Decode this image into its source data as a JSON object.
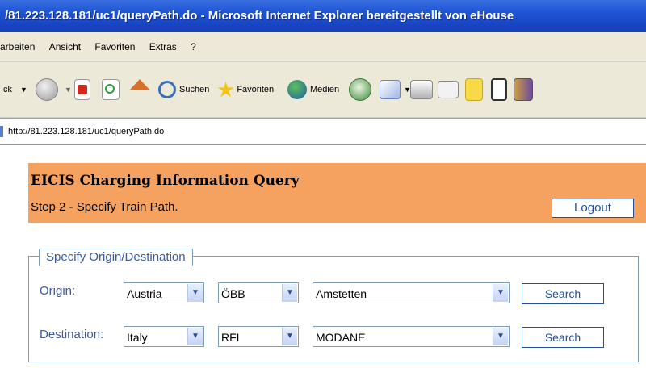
{
  "window": {
    "title": "/81.223.128.181/uc1/queryPath.do - Microsoft Internet Explorer bereitgestellt von eHouse"
  },
  "menu": {
    "items": [
      "arbeiten",
      "Ansicht",
      "Favoriten",
      "Extras",
      "?"
    ]
  },
  "toolbar": {
    "back_label": "ck",
    "search_label": "Suchen",
    "favorites_label": "Favoriten",
    "media_label": "Medien"
  },
  "address": {
    "url": "http://81.223.128.181/uc1/queryPath.do"
  },
  "page": {
    "title": "EICIS Charging Information Query",
    "step": "Step 2 - Specify Train Path.",
    "logout_label": "Logout",
    "fieldset_legend": "Specify Origin/Destination",
    "origin": {
      "label": "Origin:",
      "country": "Austria",
      "operator": "ÖBB",
      "station": "Amstetten",
      "search_label": "Search"
    },
    "destination": {
      "label": "Destination:",
      "country": "Italy",
      "operator": "RFI",
      "station": "MODANE",
      "search_label": "Search"
    }
  },
  "colors": {
    "header_bg": "#f5a160",
    "label_blue": "#3b5aa0",
    "titlebar_blue": "#1f56d6"
  }
}
